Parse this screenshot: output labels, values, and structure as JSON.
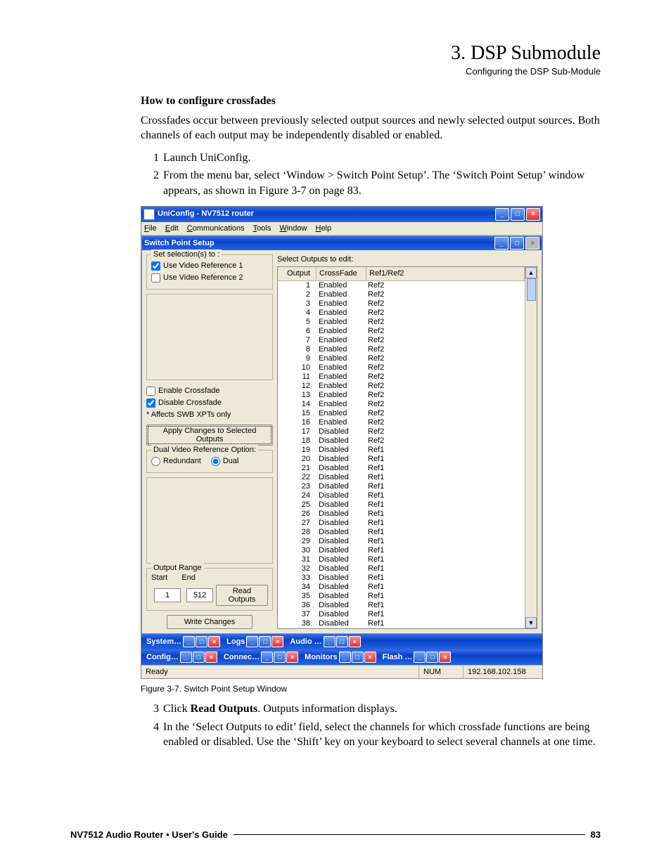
{
  "header": {
    "title": "3. DSP Submodule",
    "subtitle": "Configuring the DSP Sub-Module"
  },
  "body": {
    "h4": "How to configure crossfades",
    "p1": "Crossfades occur between previously selected output sources and newly selected output sources. Both channels of each output may be independently disabled or enabled.",
    "s1n": "1",
    "s1": "Launch UniConfig.",
    "s2n": "2",
    "s2": "From the menu bar, select ‘Window > Switch Point Setup’. The ‘Switch Point Setup’ window appears, as shown in Figure 3-7 on page 83.",
    "caption": "Figure 3-7. Switch Point Setup Window",
    "s3n": "3",
    "s3a": "Click ",
    "s3b": "Read Outputs",
    "s3c": ". Outputs information displays.",
    "s4n": "4",
    "s4": "In the ‘Select Outputs to edit’ field, select the channels for which crossfade functions are being enabled or disabled. Use the ‘Shift’ key on your keyboard to select several channels at one time."
  },
  "shot": {
    "title": "UniConfig - NV7512 router",
    "menus": {
      "file": "File",
      "edit": "Edit",
      "comm": "Communications",
      "tools": "Tools",
      "window": "Window",
      "help": "Help"
    },
    "inner_title": "Switch Point Setup",
    "set_selection": "Set selection(s) to :",
    "use_ref1": "Use Video Reference 1",
    "use_ref2": "Use Video Reference 2",
    "enable_cf": "Enable Crossfade",
    "disable_cf": "Disable Crossfade",
    "affects": "* Affects SWB XPTs only",
    "apply_btn": "Apply Changes to Selected Outputs",
    "dual_title": "Dual Video Reference Option:",
    "redundant": "Redundant",
    "dual": "Dual",
    "out_range": "Output Range",
    "start": "Start",
    "end": "End",
    "start_v": "1",
    "end_v": "512",
    "read_btn": "Read Outputs",
    "write_btn": "Write Changes",
    "select_out": "Select Outputs to edit:",
    "thead": {
      "o": "Output",
      "c": "CrossFade",
      "r": "Ref1/Ref2"
    },
    "rows": [
      {
        "o": "1",
        "c": "Enabled",
        "r": "Ref2"
      },
      {
        "o": "2",
        "c": "Enabled",
        "r": "Ref2"
      },
      {
        "o": "3",
        "c": "Enabled",
        "r": "Ref2"
      },
      {
        "o": "4",
        "c": "Enabled",
        "r": "Ref2"
      },
      {
        "o": "5",
        "c": "Enabled",
        "r": "Ref2"
      },
      {
        "o": "6",
        "c": "Enabled",
        "r": "Ref2"
      },
      {
        "o": "7",
        "c": "Enabled",
        "r": "Ref2"
      },
      {
        "o": "8",
        "c": "Enabled",
        "r": "Ref2"
      },
      {
        "o": "9",
        "c": "Enabled",
        "r": "Ref2"
      },
      {
        "o": "10",
        "c": "Enabled",
        "r": "Ref2"
      },
      {
        "o": "11",
        "c": "Enabled",
        "r": "Ref2"
      },
      {
        "o": "12",
        "c": "Enabled",
        "r": "Ref2"
      },
      {
        "o": "13",
        "c": "Enabled",
        "r": "Ref2"
      },
      {
        "o": "14",
        "c": "Enabled",
        "r": "Ref2"
      },
      {
        "o": "15",
        "c": "Enabled",
        "r": "Ref2"
      },
      {
        "o": "16",
        "c": "Enabled",
        "r": "Ref2"
      },
      {
        "o": "17",
        "c": "Disabled",
        "r": "Ref2"
      },
      {
        "o": "18",
        "c": "Disabled",
        "r": "Ref2"
      },
      {
        "o": "19",
        "c": "Disabled",
        "r": "Ref1"
      },
      {
        "o": "20",
        "c": "Disabled",
        "r": "Ref1"
      },
      {
        "o": "21",
        "c": "Disabled",
        "r": "Ref1"
      },
      {
        "o": "22",
        "c": "Disabled",
        "r": "Ref1"
      },
      {
        "o": "23",
        "c": "Disabled",
        "r": "Ref1"
      },
      {
        "o": "24",
        "c": "Disabled",
        "r": "Ref1"
      },
      {
        "o": "25",
        "c": "Disabled",
        "r": "Ref1"
      },
      {
        "o": "26",
        "c": "Disabled",
        "r": "Ref1"
      },
      {
        "o": "27",
        "c": "Disabled",
        "r": "Ref1"
      },
      {
        "o": "28",
        "c": "Disabled",
        "r": "Ref1"
      },
      {
        "o": "29",
        "c": "Disabled",
        "r": "Ref1"
      },
      {
        "o": "30",
        "c": "Disabled",
        "r": "Ref1"
      },
      {
        "o": "31",
        "c": "Disabled",
        "r": "Ref1"
      },
      {
        "o": "32",
        "c": "Disabled",
        "r": "Ref1"
      },
      {
        "o": "33",
        "c": "Disabled",
        "r": "Ref1"
      },
      {
        "o": "34",
        "c": "Disabled",
        "r": "Ref1"
      },
      {
        "o": "35",
        "c": "Disabled",
        "r": "Ref1"
      },
      {
        "o": "36",
        "c": "Disabled",
        "r": "Ref1"
      },
      {
        "o": "37",
        "c": "Disabled",
        "r": "Ref1"
      },
      {
        "o": "38",
        "c": "Disabled",
        "r": "Ref1"
      }
    ],
    "tasks": {
      "system": "System…",
      "logs": "Logs",
      "audio": "Audio …",
      "config": "Config…",
      "connec": "Connec…",
      "monitors": "Monitors",
      "flash": "Flash …"
    },
    "status": {
      "ready": "Ready",
      "num": "NUM",
      "ip": "192.168.102.158"
    }
  },
  "footer": {
    "left": "NV7512 Audio Router  •  User's Guide",
    "right": "83"
  }
}
